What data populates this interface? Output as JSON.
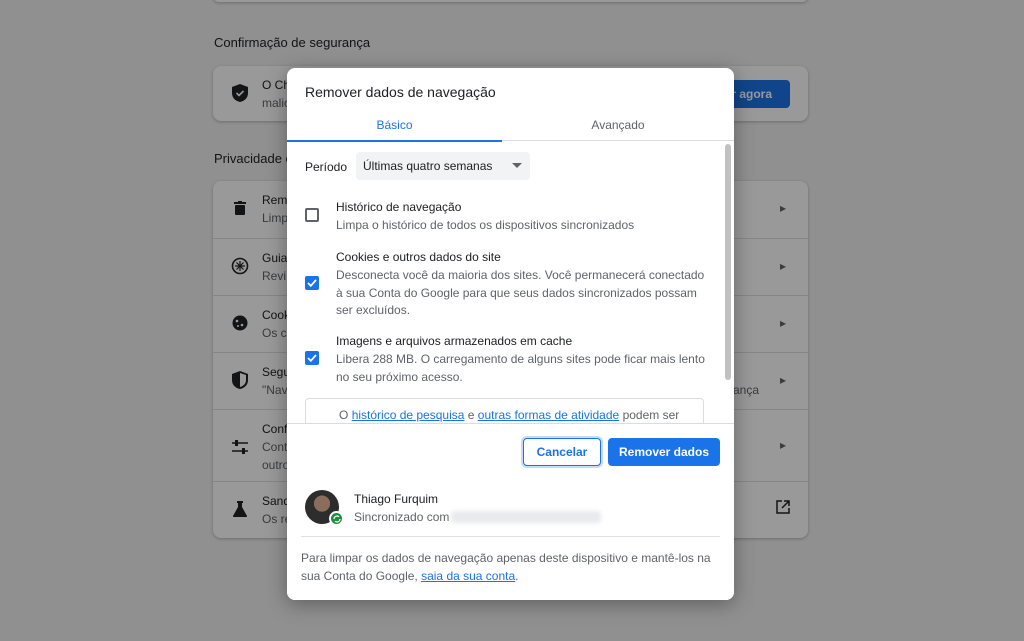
{
  "background": {
    "security_section_title": "Confirmação de segurança",
    "security_row": {
      "line1": "O Ch",
      "line2": "malic",
      "button_label": "r agora"
    },
    "privacy_section_title": "Privacidade e",
    "privacy_rows": [
      {
        "icon": "trash-icon",
        "line1": "Remo",
        "line2": "Limp"
      },
      {
        "icon": "compass-icon",
        "line1": "Guia",
        "line2": "Revi"
      },
      {
        "icon": "cookie-icon",
        "line1": "Cook",
        "line2": "Os c"
      },
      {
        "icon": "shield-icon",
        "line1": "Segu",
        "line2": "\"Nav",
        "right_text": "ança"
      },
      {
        "icon": "sliders-icon",
        "line1": "Conf",
        "line2": "Cont",
        "line3": "outro"
      },
      {
        "icon": "flask-icon",
        "line1": "Sand",
        "line2": "Os re"
      }
    ]
  },
  "dialog": {
    "title": "Remover dados de navegação",
    "tabs": [
      {
        "label": "Básico",
        "active": true
      },
      {
        "label": "Avançado",
        "active": false
      }
    ],
    "period": {
      "label": "Período",
      "selected": "Últimas quatro semanas"
    },
    "options": [
      {
        "title": "Histórico de navegação",
        "description": "Limpa o histórico de todos os dispositivos sincronizados",
        "checked": false
      },
      {
        "title": "Cookies e outros dados do site",
        "description": "Desconecta você da maioria dos sites. Você permanecerá conectado à sua Conta do Google para que seus dados sincronizados possam ser excluídos.",
        "checked": true
      },
      {
        "title": "Imagens e arquivos armazenados em cache",
        "description": "Libera 288 MB. O carregamento de alguns sites pode ficar mais lento no seu próximo acesso.",
        "checked": true
      }
    ],
    "info": {
      "prefix": "O",
      "link1": "histórico de pesquisa",
      "middle": "e",
      "link2": "outras formas de atividade",
      "suffix": "podem ser"
    },
    "buttons": {
      "cancel": "Cancelar",
      "remove": "Remover dados"
    },
    "account": {
      "name": "Thiago Furquim",
      "sync_label": "Sincronizado com",
      "note_prefix": "Para limpar os dados de navegação apenas deste dispositivo e mantê-los na sua Conta do Google,",
      "note_link": "saia da sua conta",
      "note_suffix": "."
    }
  },
  "colors": {
    "accent": "#1a73e8",
    "sync_badge": "#1e8e3e"
  }
}
